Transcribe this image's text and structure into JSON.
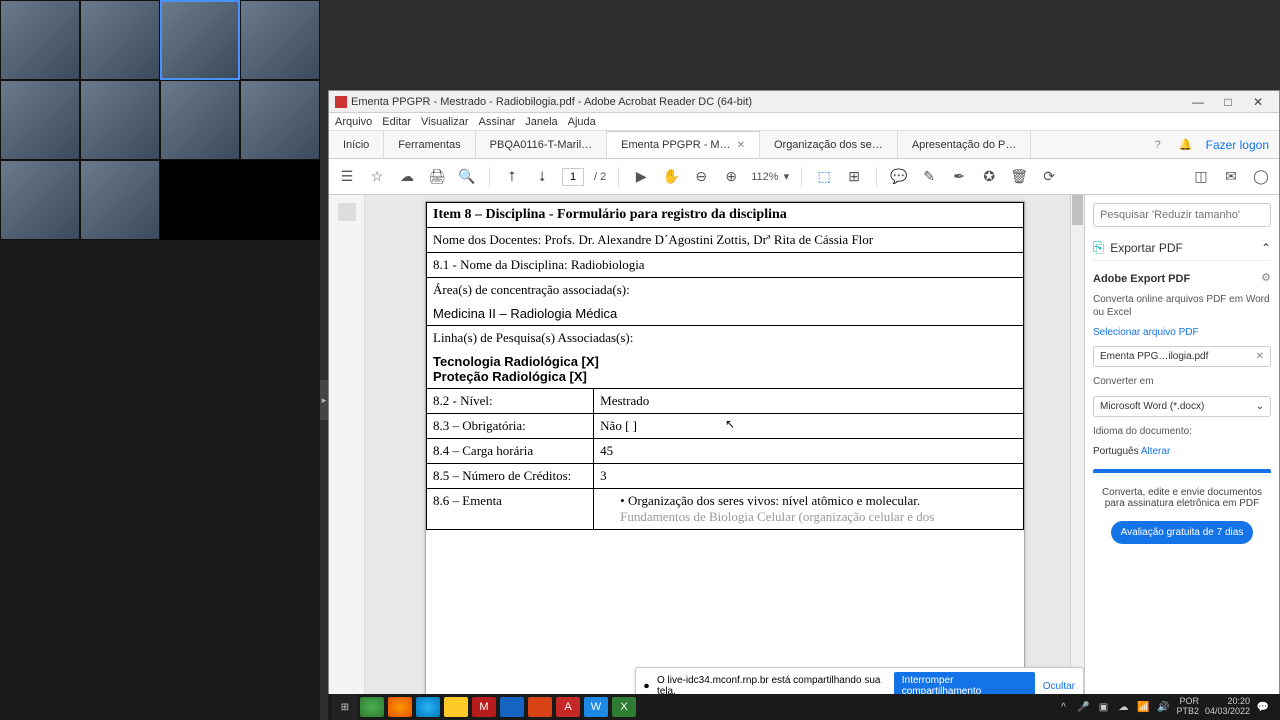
{
  "acrobat": {
    "window_title": "Ementa PPGPR - Mestrado - Radiobilogia.pdf - Adobe Acrobat Reader DC (64-bit)",
    "menu": {
      "arquivo": "Arquivo",
      "editar": "Editar",
      "visualizar": "Visualizar",
      "assinar": "Assinar",
      "janela": "Janela",
      "ajuda": "Ajuda"
    },
    "tabs": {
      "home": "Início",
      "tools": "Ferramentas",
      "t1": "PBQA0116-T-Maril…",
      "t2": "Ementa PPGPR - M…",
      "t3": "Organização dos se…",
      "t4": "Apresentação do P…"
    },
    "login": "Fazer logon",
    "page_current": "1",
    "page_total": "/ 2",
    "zoom": "112%"
  },
  "doc": {
    "title": "Item 8 – Disciplina - Formulário para registro da disciplina",
    "docentes": "Nome dos Docentes: Profs. Dr. Alexandre D´Agostini Zottis, Drª Rita de Cássia Flor",
    "nome_disc": "8.1 - Nome da Disciplina: Radiobiologia",
    "areas_label": "Área(s) de concentração associada(s):",
    "area": "Medicina II – Radiologia Médica",
    "linhas_label": "Linha(s) de Pesquisa(s) Associadas(s):",
    "linha1": "Tecnologia Radiológica   [X]",
    "linha2": "Proteção Radiológica     [X]",
    "r_nivel_l": "8.2 - Nível:",
    "r_nivel_v": "Mestrado",
    "r_obrig_l": "8.3 – Obrigatória:",
    "r_obrig_v": "Não [   ]",
    "r_carga_l": "8.4 – Carga horária",
    "r_carga_v": "45",
    "r_cred_l": "8.5 – Número de Créditos:",
    "r_cred_v": "3",
    "r_ementa_l": "8.6 – Ementa",
    "ementa_b1": "Organização dos seres vivos: nível atômico e molecular.",
    "ementa_b2": "Fundamentos de Biologia Celular (organização celular e dos"
  },
  "panel": {
    "search_placeholder": "Pesquisar 'Reduzir tamanho'",
    "export_title": "Exportar PDF",
    "adobe_export": "Adobe Export PDF",
    "convert_desc": "Converta online arquivos PDF em Word ou Excel",
    "select_file": "Selecionar arquivo PDF",
    "file_name": "Ementa PPG…ilogia.pdf",
    "convert_to": "Converter em",
    "format": "Microsoft Word (*.docx)",
    "lang_label": "Idioma do documento:",
    "lang_value": "Português",
    "lang_change": "Alterar",
    "promo": "Converta, edite e envie documentos para assinatura eletrônica em PDF",
    "trial_btn": "Avaliação gratuita de 7 dias"
  },
  "share": {
    "msg": "O live-idc34.mconf.rnp.br está compartilhando sua tela.",
    "stop": "Interromper compartilhamento",
    "hide": "Ocultar"
  },
  "taskbar": {
    "lang1": "POR",
    "lang2": "PTB2",
    "time": "20:20",
    "date": "04/03/2022"
  }
}
